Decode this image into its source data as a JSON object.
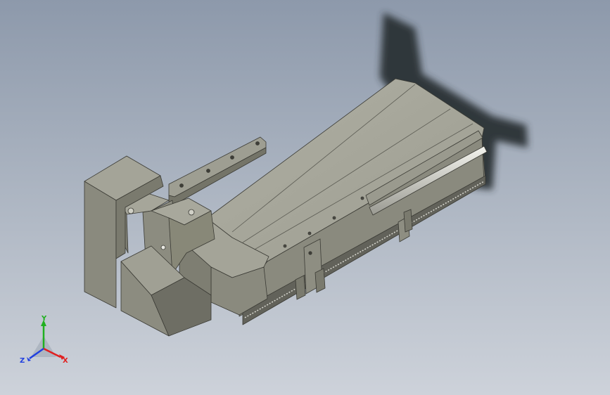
{
  "viewport": {
    "colors": {
      "background_top": "#8d99ab",
      "background_bottom": "#cdd2da",
      "part_top": "#a6a69a",
      "part_side": "#8c8c80",
      "part_dark": "#6e6e64",
      "shadow": "#2c3034"
    }
  },
  "triad": {
    "x_label": "X",
    "y_label": "Y",
    "z_label": "Z",
    "x_color": "#e02020",
    "y_color": "#20b020",
    "z_color": "#2040e0"
  }
}
